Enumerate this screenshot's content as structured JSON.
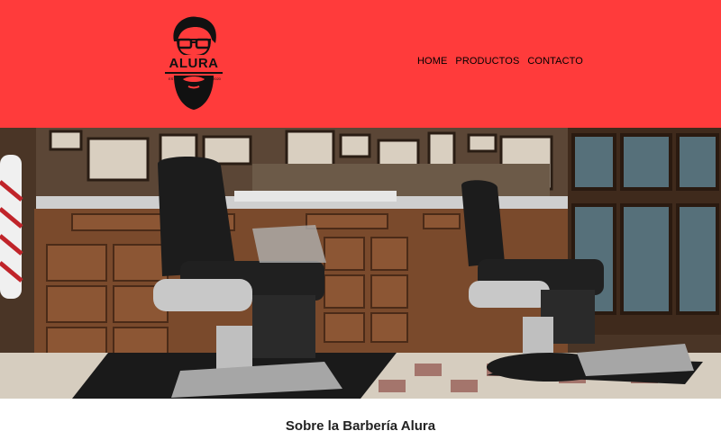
{
  "header": {
    "background": "#ff3b3b",
    "logo": {
      "text": "ALURA",
      "icon": "bearded-man-logo-icon"
    },
    "nav": [
      {
        "label": "HOME"
      },
      {
        "label": "PRODUCTOS"
      },
      {
        "label": "CONTACTO"
      }
    ]
  },
  "hero": {
    "image": "barbershop-interior-photo"
  },
  "about": {
    "title": "Sobre la Barbería Alura"
  }
}
